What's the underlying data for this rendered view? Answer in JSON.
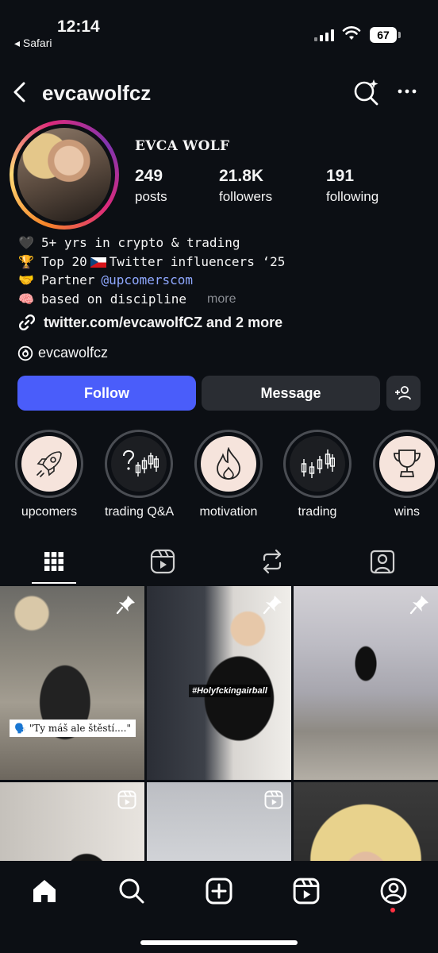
{
  "status_bar": {
    "time": "12:14",
    "back_app": "◂ Safari",
    "battery": "67"
  },
  "header": {
    "username": "evcawolfcz",
    "icons": [
      "back-chevron-icon",
      "ai-search-icon",
      "more-icon"
    ]
  },
  "profile": {
    "display_name": "EVCA WOLF",
    "stats": [
      {
        "value": "249",
        "label": "posts"
      },
      {
        "value": "21.8K",
        "label": "followers"
      },
      {
        "value": "191",
        "label": "following"
      }
    ]
  },
  "bio": {
    "lines": [
      {
        "emoji": "🖤",
        "text": "5+ yrs in crypto & trading"
      },
      {
        "emoji": "🏆",
        "text_before": "Top 20",
        "text_after": "Twitter influencers ‘25"
      },
      {
        "emoji": "🤝",
        "text": "Partner",
        "mention": "@upcomerscom"
      },
      {
        "emoji": "🧠",
        "text": "based on discipline",
        "more": "more"
      }
    ],
    "link": "twitter.com/evcawolfCZ and 2 more",
    "threads_handle": "evcawolfcz"
  },
  "actions": {
    "follow": "Follow",
    "message": "Message"
  },
  "highlights": [
    {
      "label": "upcomers",
      "icon": "rocket-icon"
    },
    {
      "label": "trading Q&A",
      "icon": "question-chart-icon"
    },
    {
      "label": "motivation",
      "icon": "flame-icon"
    },
    {
      "label": "trading",
      "icon": "candlestick-icon"
    },
    {
      "label": "wins",
      "icon": "trophy-icon"
    }
  ],
  "tabs": [
    "grid-icon",
    "reels-icon",
    "reposts-icon",
    "tagged-icon"
  ],
  "posts": [
    {
      "caption": "🗣️ \"Ty máš ale štěstí....\"",
      "badge": "pin-icon"
    },
    {
      "caption": "#Holyfckingairball",
      "badge": "pin-icon"
    },
    {
      "caption": "",
      "badge": "pin-icon"
    },
    {
      "caption": "",
      "badge": "reels-icon"
    },
    {
      "caption": "",
      "badge": "reels-icon"
    },
    {
      "caption": "",
      "badge": ""
    }
  ],
  "bottom_nav": [
    "home-icon",
    "search-icon",
    "create-icon",
    "reels-icon",
    "profile-icon"
  ],
  "colors": {
    "background": "#0c0f14",
    "follow_button": "#4a5dfa",
    "secondary_button": "#2a2d33",
    "mention": "#8fa8ff",
    "notification_dot": "#ff3040"
  }
}
